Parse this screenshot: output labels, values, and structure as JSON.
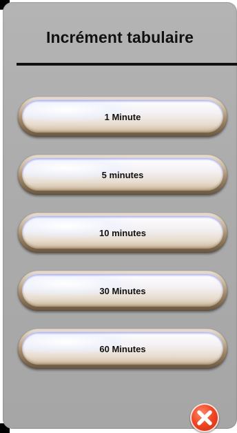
{
  "dialog": {
    "title": "Incrément tabulaire"
  },
  "options": [
    {
      "label": "1 Minute"
    },
    {
      "label": "5 minutes"
    },
    {
      "label": "10 minutes"
    },
    {
      "label": "30 Minutes"
    },
    {
      "label": "60 Minutes"
    }
  ],
  "close_button": {
    "icon": "close-icon",
    "color": "#e8401f"
  }
}
